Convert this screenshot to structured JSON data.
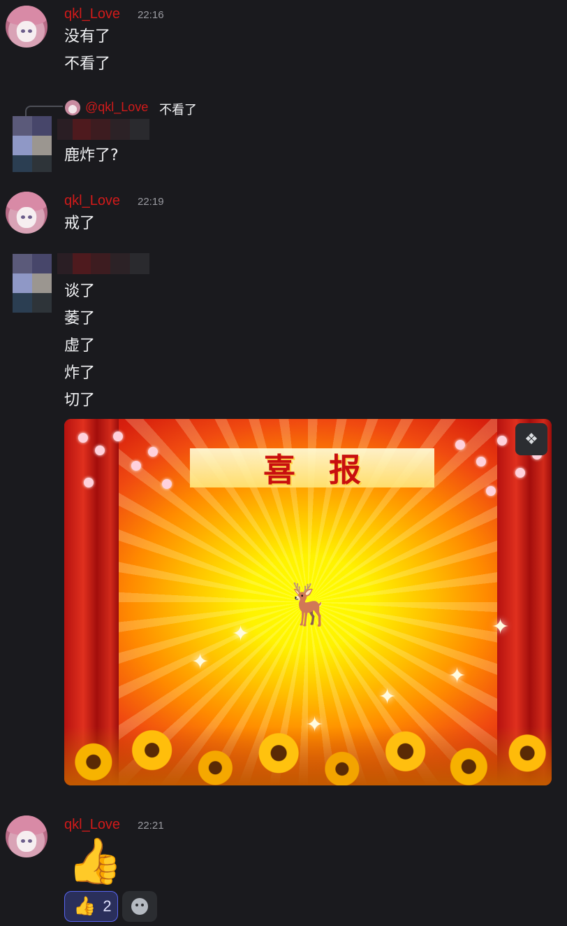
{
  "messages": [
    {
      "author": "qkl_Love",
      "time": "22:16",
      "lines": [
        "没有了",
        "不看了"
      ]
    },
    {
      "reply_mention": "@qkl_Love",
      "reply_text": "不看了",
      "lines": [
        "鹿炸了?"
      ]
    },
    {
      "author": "qkl_Love",
      "time": "22:19",
      "lines": [
        "戒了"
      ]
    },
    {
      "lines": [
        "谈了",
        "萎了",
        "虚了",
        "炸了",
        "切了"
      ]
    },
    {
      "author": "qkl_Love",
      "time": "22:21"
    }
  ],
  "image": {
    "banner_chars": [
      "喜",
      "报"
    ],
    "center_emoji": "🦌",
    "action_icon": "media-action-icon"
  },
  "big_emoji": "👍",
  "reactions": [
    {
      "emoji": "👍",
      "count": "2"
    }
  ],
  "colors": {
    "author": "#d11a1a",
    "background": "#1a1a1e",
    "reaction_active_border": "#5865f2"
  }
}
